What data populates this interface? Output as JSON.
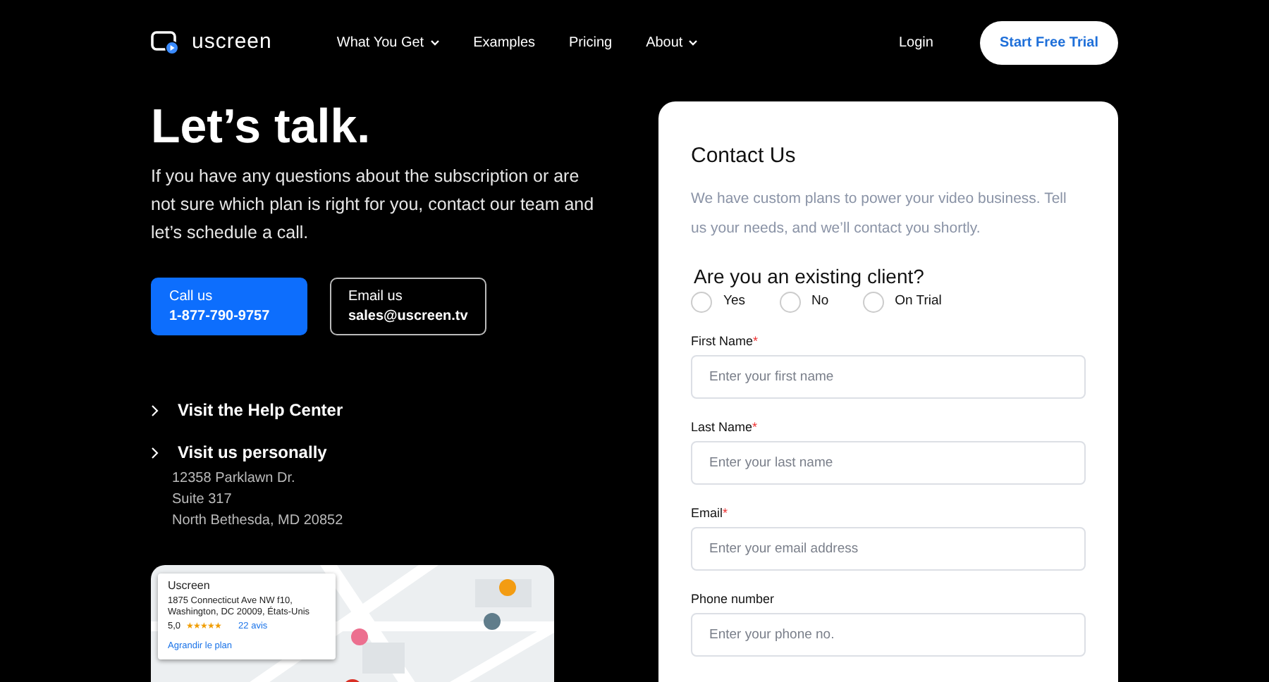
{
  "nav": {
    "brand": "uscreen",
    "links": [
      {
        "label": "What You Get",
        "dropdown": true
      },
      {
        "label": "Examples",
        "dropdown": false
      },
      {
        "label": "Pricing",
        "dropdown": false
      },
      {
        "label": "About",
        "dropdown": true
      }
    ],
    "login": "Login",
    "cta": "Start Free Trial"
  },
  "hero": {
    "title": "Let’s talk.",
    "text": "If you have any questions about the subscription or are not sure which plan is right for you, contact our team and let’s schedule a call."
  },
  "contacts": [
    {
      "kind": "primary",
      "label": "Call us",
      "value": "1-877-790-9757"
    },
    {
      "kind": "outline",
      "label": "Email us",
      "value": "sales@uscreen.tv"
    }
  ],
  "links": [
    {
      "label": "Visit the Help Center"
    },
    {
      "label": "Visit us personally",
      "lines": [
        "12358 Parklawn Dr.",
        "Suite 317",
        "North Bethesda, MD 20852"
      ]
    }
  ],
  "map": {
    "kind": "picture",
    "place": {
      "name": "Uscreen",
      "address": [
        "1875 Connecticut Ave NW f10,",
        "Washington, DC 20009, États-Unis"
      ],
      "rating": "5,0",
      "stars": 5,
      "reviews": "22 avis",
      "link": "Agrandir le plan"
    }
  },
  "form": {
    "title": "Contact Us",
    "intro": "We have custom plans to power your video business. Tell us your needs, and we’ll contact you shortly.",
    "question": "Are you an existing client?",
    "options": [
      {
        "label": "Yes",
        "selected": false
      },
      {
        "label": "No",
        "selected": false
      },
      {
        "label": "On Trial",
        "selected": false
      }
    ],
    "fields": [
      {
        "label": "First Name",
        "required_mark": "*",
        "placeholder": "Enter your first name"
      },
      {
        "label": "Last Name",
        "required_mark": "*",
        "placeholder": "Enter your last name"
      },
      {
        "label": "Email",
        "required_mark": "*",
        "placeholder": "Enter your email address"
      },
      {
        "label": "Phone number",
        "placeholder": "Enter your phone no."
      }
    ]
  }
}
